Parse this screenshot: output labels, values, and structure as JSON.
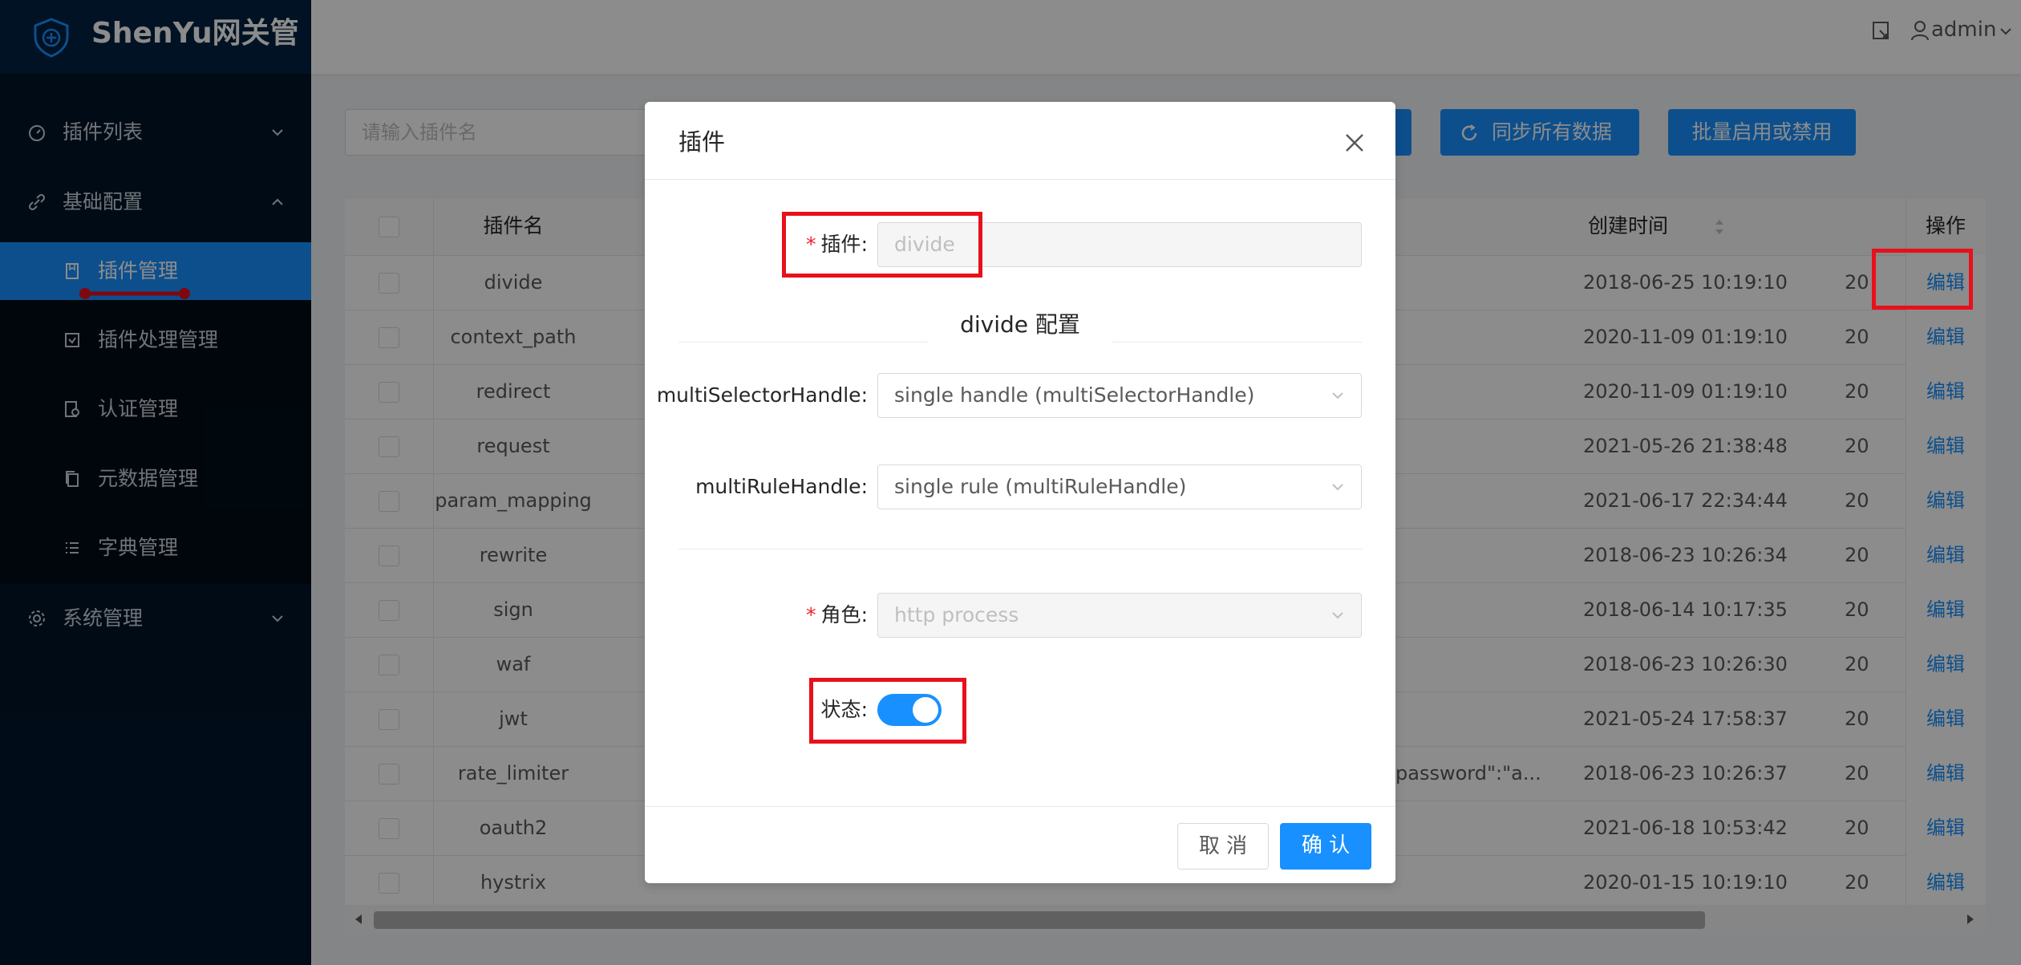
{
  "app": {
    "title": "ShenYu网关管"
  },
  "header": {
    "user": "admin"
  },
  "sidebar": {
    "items": [
      {
        "label": "插件列表"
      },
      {
        "label": "基础配置"
      },
      {
        "label": "插件管理"
      },
      {
        "label": "插件处理管理"
      },
      {
        "label": "认证管理"
      },
      {
        "label": "元数据管理"
      },
      {
        "label": "字典管理"
      },
      {
        "label": "系统管理"
      }
    ]
  },
  "toolbar": {
    "search_placeholder": "请输入插件名",
    "sync_label": "同步所有数据",
    "batch_label": "批量启用或禁用"
  },
  "table": {
    "columns": {
      "name": "插件名",
      "created": "创建时间",
      "actions": "操作"
    },
    "edit_label": "编辑",
    "rows": [
      {
        "name": "divide",
        "created": "2018-06-25 10:19:10",
        "updated": "20",
        "extra": ""
      },
      {
        "name": "context_path",
        "created": "2020-11-09 01:19:10",
        "updated": "20",
        "extra": ""
      },
      {
        "name": "redirect",
        "created": "2020-11-09 01:19:10",
        "updated": "20",
        "extra": ""
      },
      {
        "name": "request",
        "created": "2021-05-26 21:38:48",
        "updated": "20",
        "extra": ""
      },
      {
        "name": "param_mapping",
        "created": "2021-06-17 22:34:44",
        "updated": "20",
        "extra": ""
      },
      {
        "name": "rewrite",
        "created": "2018-06-23 10:26:34",
        "updated": "20",
        "extra": ""
      },
      {
        "name": "sign",
        "created": "2018-06-14 10:17:35",
        "updated": "20",
        "extra": ""
      },
      {
        "name": "waf",
        "created": "2018-06-23 10:26:30",
        "updated": "20",
        "extra": ""
      },
      {
        "name": "jwt",
        "created": "2021-05-24 17:58:37",
        "updated": "20",
        "extra": ""
      },
      {
        "name": "rate_limiter",
        "created": "2018-06-23 10:26:37",
        "updated": "20",
        "extra": "password\":\"a..."
      },
      {
        "name": "oauth2",
        "created": "2021-06-18 10:53:42",
        "updated": "20",
        "extra": ""
      },
      {
        "name": "hystrix",
        "created": "2020-01-15 10:19:10",
        "updated": "20",
        "extra": ""
      }
    ]
  },
  "modal": {
    "title": "插件",
    "plugin_label": "插件",
    "plugin_value": "divide",
    "config_title": "divide 配置",
    "multi_selector_label": "multiSelectorHandle",
    "multi_selector_value": "single handle (multiSelectorHandle)",
    "multi_rule_label": "multiRuleHandle",
    "multi_rule_value": "single rule (multiRuleHandle)",
    "role_label": "角色",
    "role_value": "http process",
    "status_label": "状态",
    "status_on": true,
    "cancel_label": "取 消",
    "confirm_label": "确 认"
  },
  "colors": {
    "primary": "#1890ff",
    "sidebar": "#001529",
    "highlight": "#e8101a"
  }
}
